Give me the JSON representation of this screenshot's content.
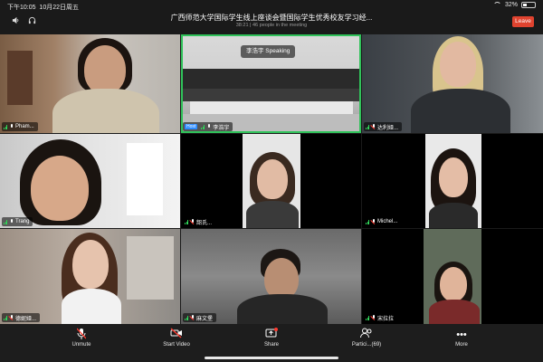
{
  "status_bar": {
    "time": "下午10:05",
    "date": "10月22日周五",
    "battery": "32%",
    "battery_level": 0.32
  },
  "meeting": {
    "title": "广西师范大学国际学生线上座谈会暨国际学生优秀校友学习经...",
    "elapsed": "38:21",
    "people": "46 people in the meeting",
    "leave_label": "Leave"
  },
  "speaking_label": "李浩宇 Speaking",
  "host_label": "Host",
  "tiles": [
    {
      "name": "Pham...",
      "muted": false
    },
    {
      "name": "李浩宇",
      "muted": false,
      "host": true,
      "active": true
    },
    {
      "name": "达利娅...",
      "muted": true
    },
    {
      "name": "Trang",
      "muted": false
    },
    {
      "name": "韶氏...",
      "muted": true
    },
    {
      "name": "Michel...",
      "muted": true
    },
    {
      "name": "德妮娅...",
      "muted": true
    },
    {
      "name": "麻文堡",
      "muted": true
    },
    {
      "name": "宋拉拉",
      "muted": true
    }
  ],
  "toolbar": {
    "unmute": "Unmute",
    "start_video": "Start Video",
    "share": "Share",
    "participants": "Partici...(69)",
    "more": "More"
  },
  "icons": [
    "wifi-icon",
    "battery-icon",
    "speaker-icon",
    "headphones-icon",
    "mic-icon",
    "video-icon",
    "share-icon",
    "participants-icon",
    "more-icon"
  ]
}
